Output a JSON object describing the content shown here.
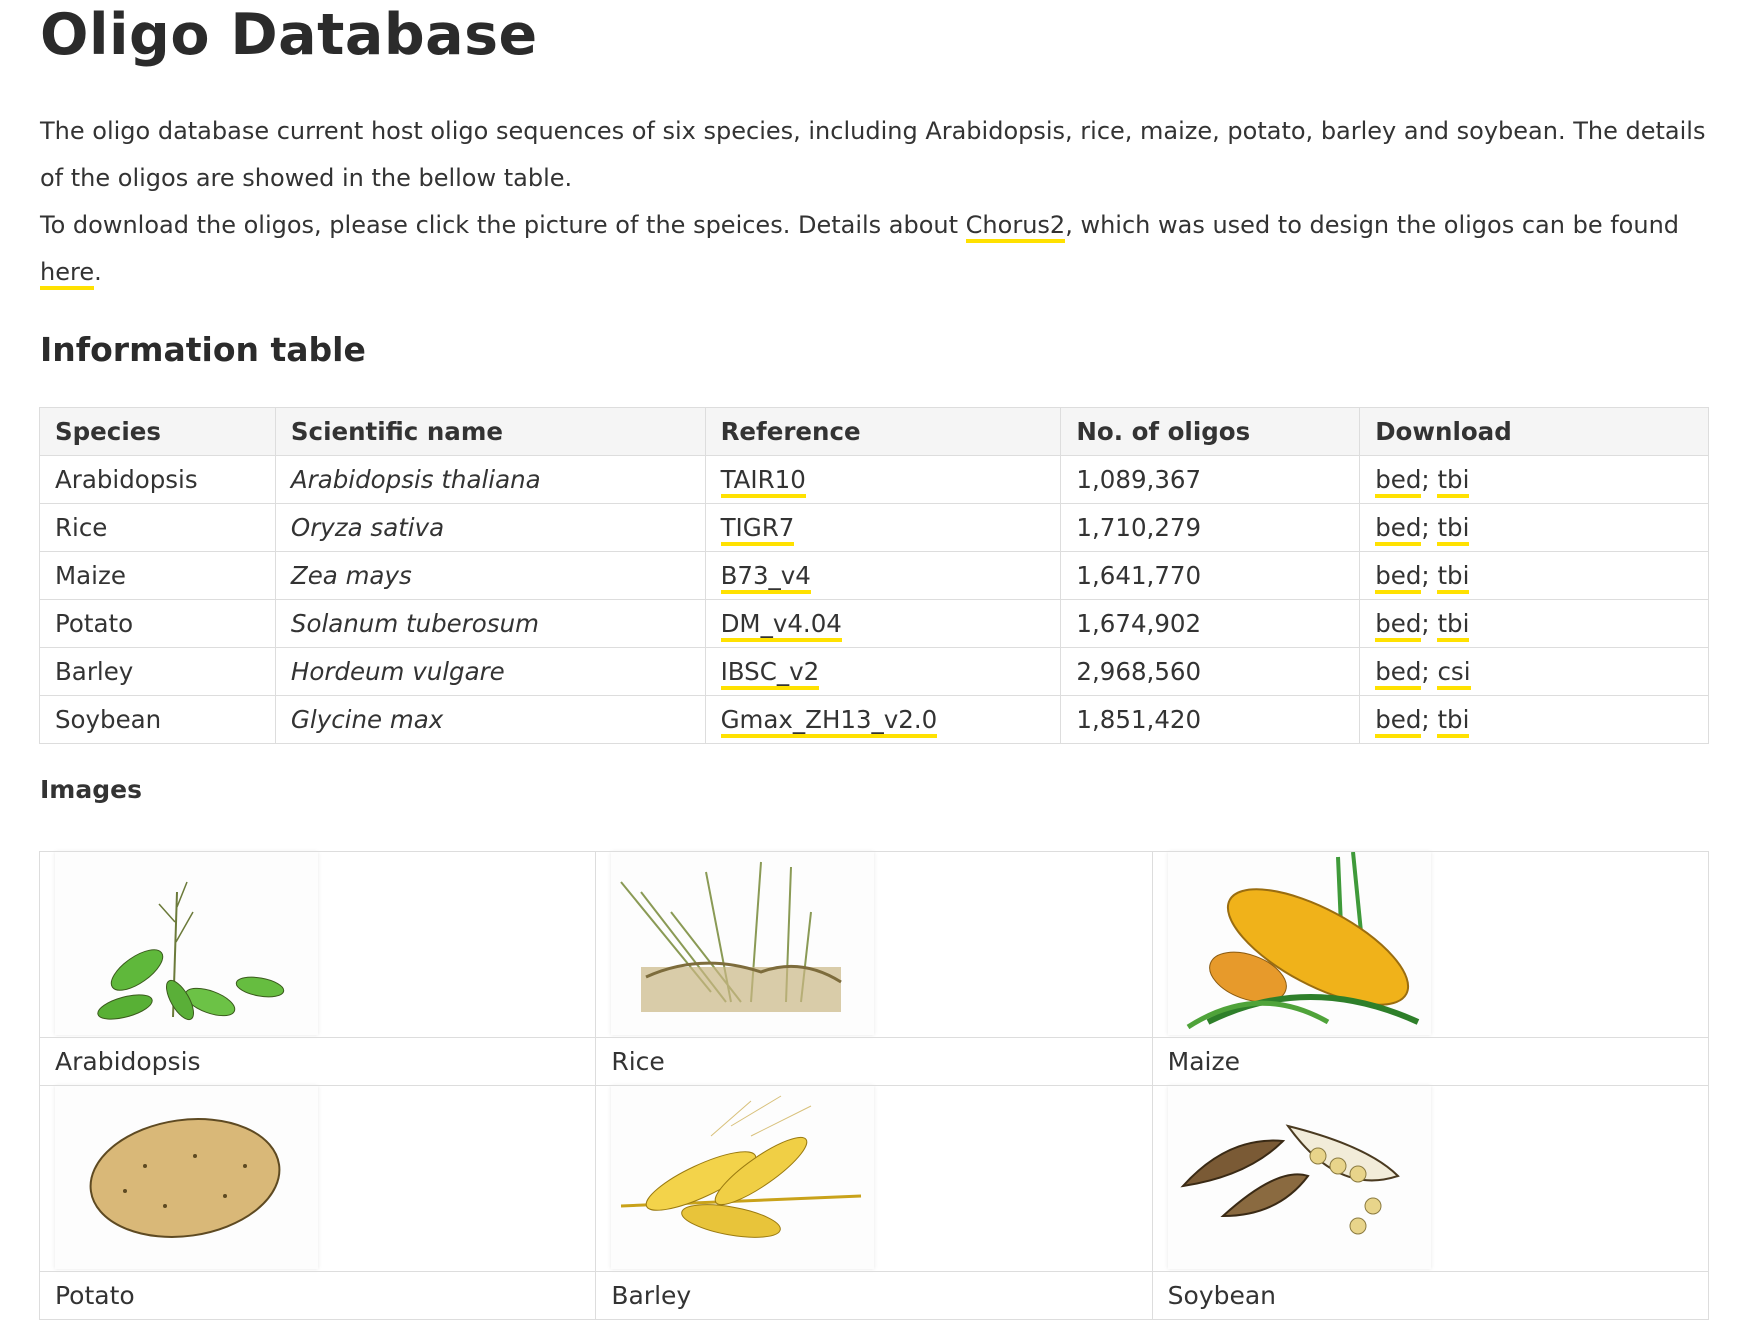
{
  "page": {
    "title": "Oligo Database",
    "intro": {
      "line1": "The oligo database current host oligo sequences of six species, including Arabidopsis, rice, maize, potato, barley and soybean. The details of the oligos are showed in the bellow table.",
      "line2_before": "To download the oligos, please click the picture of the speices. Details about ",
      "chorus_link": "Chorus2",
      "line2_after": ", which was used to design the oligos can be found ",
      "here_link": "here",
      "line2_end": "."
    },
    "table_heading": "Information table",
    "images_heading": "Images",
    "link_underline_color": "#ffe100"
  },
  "info_table": {
    "headers": [
      "Species",
      "Scientific name",
      "Reference",
      "No. of oligos",
      "Download"
    ],
    "rows": [
      {
        "species": "Arabidopsis",
        "scientific": "Arabidopsis thaliana",
        "reference": "TAIR10",
        "oligos": "1,089,367",
        "dl1": "bed",
        "sep": ";",
        "dl2": "tbi"
      },
      {
        "species": "Rice",
        "scientific": "Oryza sativa",
        "reference": "TIGR7",
        "oligos": "1,710,279",
        "dl1": "bed",
        "sep": ";",
        "dl2": "tbi"
      },
      {
        "species": "Maize",
        "scientific": "Zea mays",
        "reference": "B73_v4",
        "oligos": "1,641,770",
        "dl1": "bed",
        "sep": ";",
        "dl2": "tbi"
      },
      {
        "species": "Potato",
        "scientific": "Solanum tuberosum",
        "reference": "DM_v4.04",
        "oligos": "1,674,902",
        "dl1": "bed",
        "sep": ";",
        "dl2": "tbi"
      },
      {
        "species": "Barley",
        "scientific": "Hordeum vulgare",
        "reference": "IBSC_v2",
        "oligos": "2,968,560",
        "dl1": "bed",
        "sep": ";",
        "dl2": "csi"
      },
      {
        "species": "Soybean",
        "scientific": "Glycine max",
        "reference": "Gmax_ZH13_v2.0",
        "oligos": "1,851,420",
        "dl1": "bed",
        "sep": ";",
        "dl2": "tbi"
      }
    ]
  },
  "images": [
    {
      "caption": "Arabidopsis",
      "icon": "arabidopsis-plant-image"
    },
    {
      "caption": "Rice",
      "icon": "rice-plant-image"
    },
    {
      "caption": "Maize",
      "icon": "maize-cob-image"
    },
    {
      "caption": "Potato",
      "icon": "potato-image"
    },
    {
      "caption": "Barley",
      "icon": "barley-ears-image"
    },
    {
      "caption": "Soybean",
      "icon": "soybean-pods-image"
    }
  ]
}
